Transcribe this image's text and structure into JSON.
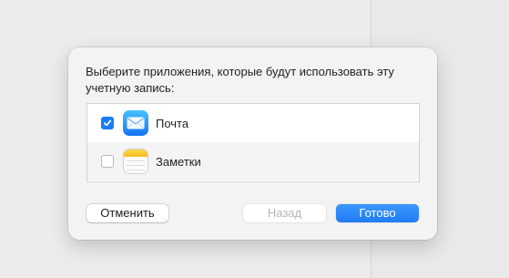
{
  "dialog": {
    "prompt": "Выберите приложения, которые будут использовать эту учетную запись:",
    "apps": [
      {
        "name": "Почта",
        "checked": true,
        "icon": "mail-icon"
      },
      {
        "name": "Заметки",
        "checked": false,
        "icon": "notes-icon"
      }
    ],
    "buttons": {
      "cancel": "Отменить",
      "back": "Назад",
      "done": "Готово"
    }
  },
  "colors": {
    "accent": "#1a7cf4",
    "background": "#ececec",
    "dialog": "#f3f3f3"
  }
}
